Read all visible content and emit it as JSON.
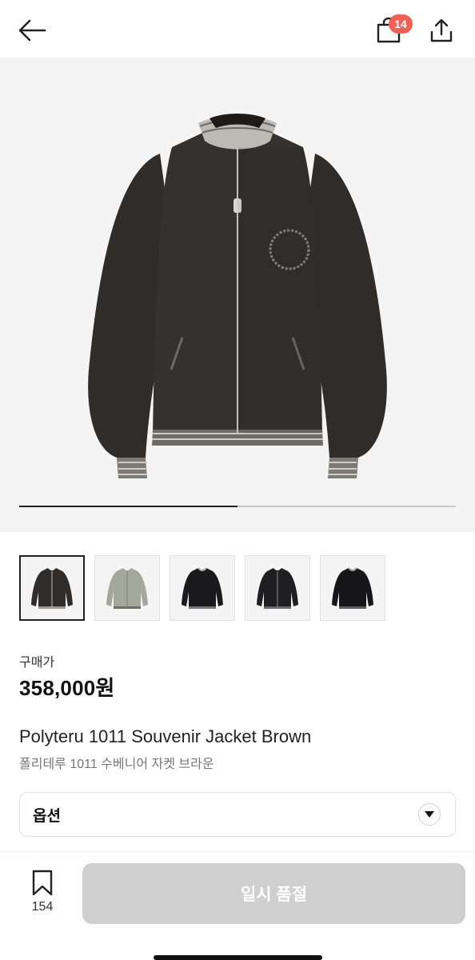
{
  "header": {
    "back_icon": "arrow-left-icon",
    "bag_icon": "shopping-bag-icon",
    "bag_count": "14",
    "share_icon": "share-upload-icon"
  },
  "gallery": {
    "current_image": 1,
    "total_images": 2,
    "thumbnail_count": 5
  },
  "product": {
    "price_label": "구매가",
    "price": "358,000원",
    "name_en": "Polyteru 1011 Souvenir Jacket Brown",
    "name_ko": "폴리테루 1011 수베니어 자켓 브라운"
  },
  "option": {
    "label": "옵션",
    "caret_icon": "caret-down-icon"
  },
  "bottom": {
    "bookmark_icon": "bookmark-icon",
    "bookmark_count": "154",
    "soldout_label": "일시 품절"
  },
  "colors": {
    "badge": "#ef6253",
    "disabled_button": "#cfcfcf",
    "hero_background": "#f4f4f4"
  }
}
